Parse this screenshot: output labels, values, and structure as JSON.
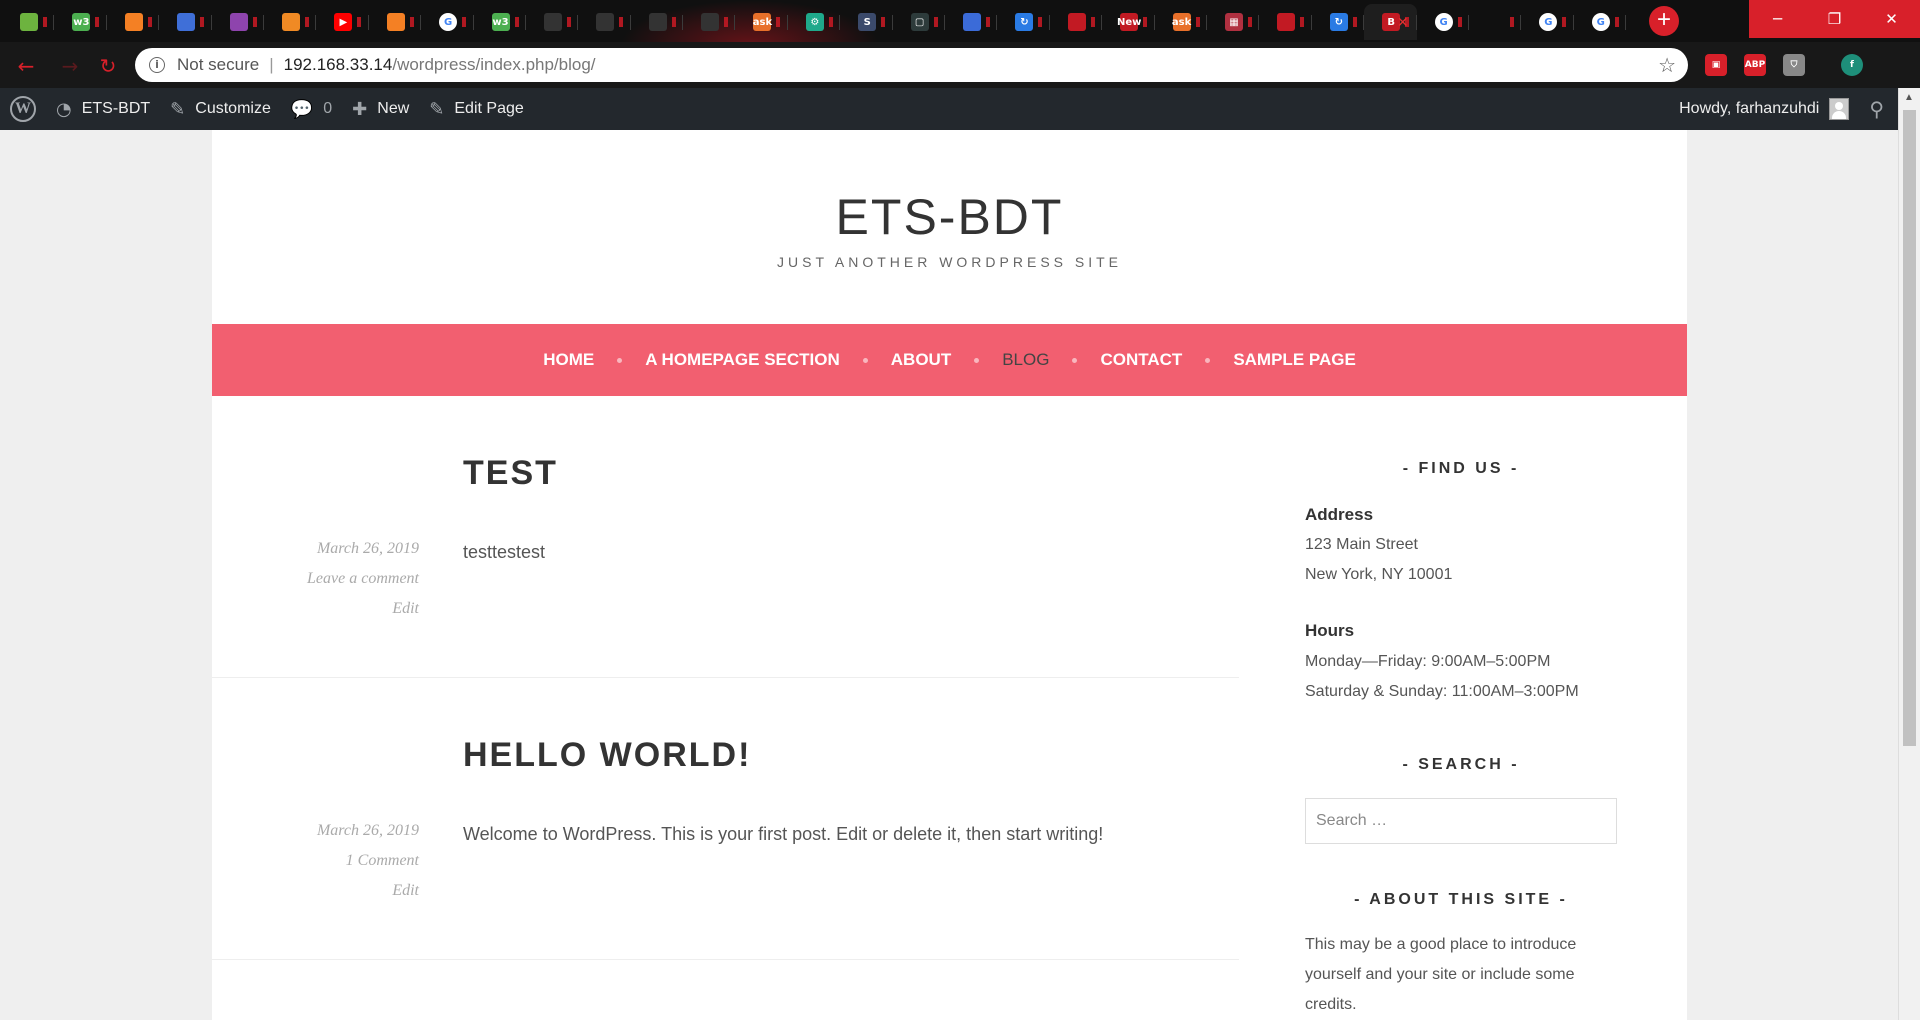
{
  "browser": {
    "tabs": [
      {
        "icon": "spring-icon",
        "color": "#6db33f",
        "glyph": ""
      },
      {
        "icon": "w3schools-icon",
        "color": "#4caf50",
        "glyph": "w3"
      },
      {
        "icon": "stackoverflow-icon",
        "color": "#f48024",
        "glyph": ""
      },
      {
        "icon": "cloud-icon",
        "color": "#3f6fd8",
        "glyph": ""
      },
      {
        "icon": "contacts-icon",
        "color": "#8e44ad",
        "glyph": ""
      },
      {
        "icon": "share-icon",
        "color": "#f08a24",
        "glyph": ""
      },
      {
        "icon": "youtube-icon",
        "color": "#ff0000",
        "glyph": "▶"
      },
      {
        "icon": "stackoverflow-icon",
        "color": "#f48024",
        "glyph": ""
      },
      {
        "icon": "google-icon",
        "color": "#ffffff",
        "glyph": "G"
      },
      {
        "icon": "w3schools-icon",
        "color": "#4caf50",
        "glyph": "w3"
      },
      {
        "icon": "github-icon",
        "color": "#333333",
        "glyph": ""
      },
      {
        "icon": "github-icon",
        "color": "#333333",
        "glyph": ""
      },
      {
        "icon": "github-icon",
        "color": "#333333",
        "glyph": ""
      },
      {
        "icon": "github-icon",
        "color": "#333333",
        "glyph": ""
      },
      {
        "icon": "ask-icon",
        "color": "#e8702a",
        "glyph": "ask"
      },
      {
        "icon": "gear-icon",
        "color": "#1fa98b",
        "glyph": "⚙"
      },
      {
        "icon": "scribd-icon",
        "color": "#3b4a6b",
        "glyph": "S"
      },
      {
        "icon": "window-icon",
        "color": "#2d3b3b",
        "glyph": "▢"
      },
      {
        "icon": "shield-icon",
        "color": "#3b6bd8",
        "glyph": ""
      },
      {
        "icon": "sync-icon",
        "color": "#2a7be4",
        "glyph": "↻"
      },
      {
        "icon": "pdf-icon",
        "color": "#c21a23",
        "glyph": ""
      },
      {
        "icon": "new-icon",
        "color": "#c21a23",
        "glyph": "New"
      },
      {
        "icon": "ask-icon",
        "color": "#e8702a",
        "glyph": "ask"
      },
      {
        "icon": "grid-icon",
        "color": "#b03040",
        "glyph": "▦"
      },
      {
        "icon": "pdf-icon",
        "color": "#c21a23",
        "glyph": ""
      },
      {
        "icon": "sync-icon",
        "color": "#2a7be4",
        "glyph": "↻"
      },
      {
        "icon": "blog-icon",
        "color": "#c21a23",
        "glyph": "B",
        "active": true
      },
      {
        "icon": "google-icon",
        "color": "#ffffff",
        "glyph": "G"
      },
      {
        "icon": "blank-icon",
        "color": "#101010",
        "glyph": ""
      },
      {
        "icon": "google-icon",
        "color": "#ffffff",
        "glyph": "G"
      },
      {
        "icon": "google-icon",
        "color": "#ffffff",
        "glyph": "G"
      }
    ],
    "new_tab_glyph": "+",
    "window_controls": {
      "minimize": "─",
      "restore": "❐",
      "close": "✕"
    },
    "address": {
      "security_label": "Not secure",
      "separator": "|",
      "host": "192.168.33.14",
      "path": "/wordpress/index.php/blog/"
    },
    "extensions": [
      {
        "icon": "pocket-icon",
        "color": "#d8202a",
        "glyph": "▣"
      },
      {
        "icon": "adblock-icon",
        "color": "#d8202a",
        "glyph": "ABP"
      },
      {
        "icon": "shield-ext-icon",
        "color": "#888888",
        "glyph": "⛉"
      },
      {
        "icon": "profile-icon",
        "color": "#1e8f7a",
        "glyph": "f"
      }
    ]
  },
  "adminbar": {
    "site_name": "ETS-BDT",
    "customize": "Customize",
    "comments_count": "0",
    "new_label": "New",
    "edit_page": "Edit Page",
    "greeting": "Howdy, farhanzuhdi"
  },
  "site": {
    "title": "ETS-BDT",
    "tagline": "JUST ANOTHER WORDPRESS SITE",
    "accent_color": "#f25f70",
    "nav": [
      {
        "label": "HOME",
        "current": false
      },
      {
        "label": "A HOMEPAGE SECTION",
        "current": false
      },
      {
        "label": "ABOUT",
        "current": false
      },
      {
        "label": "BLOG",
        "current": true
      },
      {
        "label": "CONTACT",
        "current": false
      },
      {
        "label": "SAMPLE PAGE",
        "current": false
      }
    ]
  },
  "posts": [
    {
      "title": "TEST",
      "date": "March 26, 2019",
      "comments": "Leave a comment",
      "edit": "Edit",
      "excerpt": "testtestest"
    },
    {
      "title": "HELLO WORLD!",
      "date": "March 26, 2019",
      "comments": "1 Comment",
      "edit": "Edit",
      "excerpt": "Welcome to WordPress. This is your first post. Edit or delete it, then start writing!"
    }
  ],
  "sidebar": {
    "find_us": {
      "title": "- FIND US -",
      "address_label": "Address",
      "address_line1": "123 Main Street",
      "address_line2": "New York, NY 10001",
      "hours_label": "Hours",
      "hours_line1": "Monday—Friday: 9:00AM–5:00PM",
      "hours_line2": "Saturday & Sunday: 11:00AM–3:00PM"
    },
    "search": {
      "title": "- SEARCH -",
      "placeholder": "Search …"
    },
    "about": {
      "title": "- ABOUT THIS SITE -",
      "line1": "This may be a good place to introduce",
      "line2": "yourself and your site or include some",
      "line3": "credits."
    }
  }
}
